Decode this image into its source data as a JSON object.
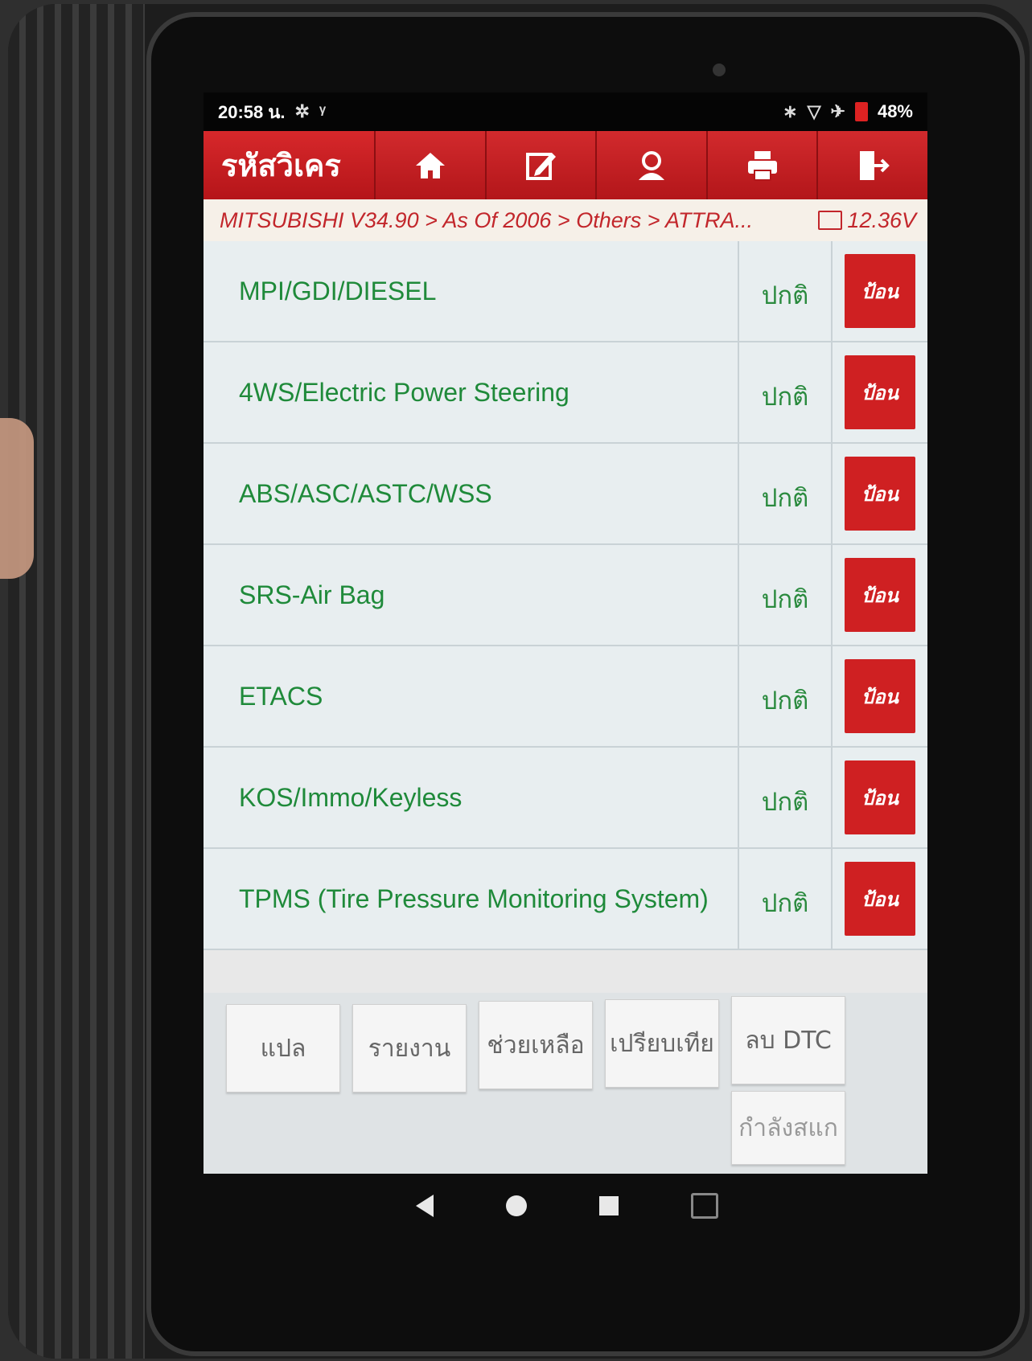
{
  "status_bar": {
    "time": "20:58 น.",
    "battery": "48%"
  },
  "toolbar": {
    "title": "รหัสวิเคร",
    "buttons": [
      {
        "icon": "home-icon"
      },
      {
        "icon": "edit-icon"
      },
      {
        "icon": "user-icon"
      },
      {
        "icon": "print-icon"
      },
      {
        "icon": "exit-icon"
      }
    ]
  },
  "breadcrumb": {
    "path": "MITSUBISHI V34.90 > As Of 2006 > Others > ATTRA...",
    "voltage": "12.36V"
  },
  "systems": [
    {
      "name": "MPI/GDI/DIESEL",
      "status": "ปกติ",
      "action": "ป้อน"
    },
    {
      "name": "4WS/Electric Power Steering",
      "status": "ปกติ",
      "action": "ป้อน"
    },
    {
      "name": "ABS/ASC/ASTC/WSS",
      "status": "ปกติ",
      "action": "ป้อน"
    },
    {
      "name": "SRS-Air Bag",
      "status": "ปกติ",
      "action": "ป้อน"
    },
    {
      "name": "ETACS",
      "status": "ปกติ",
      "action": "ป้อน"
    },
    {
      "name": "KOS/Immo/Keyless",
      "status": "ปกติ",
      "action": "ป้อน"
    },
    {
      "name": "TPMS (Tire Pressure Monitoring System)",
      "status": "ปกติ",
      "action": "ป้อน"
    }
  ],
  "actions": {
    "translate": "แปล",
    "report": "รายงาน",
    "help": "ช่วยเหลือ",
    "compare": "เปรียบเทีย",
    "clear_dtc": "ลบ DTC",
    "scanning": "กำลังสแก"
  },
  "colors": {
    "toolbar_red": "#c91d21",
    "system_green": "#1f8a3a",
    "breadcrumb_red": "#c2262b"
  }
}
